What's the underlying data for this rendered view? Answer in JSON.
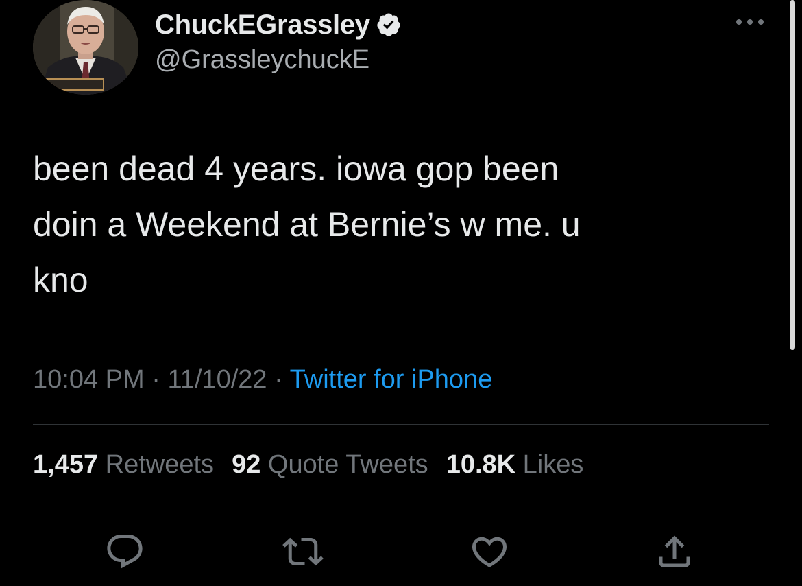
{
  "profile": {
    "display_name": "ChuckEGrassley",
    "handle": "@GrassleychuckE",
    "verified": true,
    "avatar_nameplate": "GRASSLEY"
  },
  "tweet": {
    "text": "been dead 4 years. iowa gop been\ndoin a Weekend at Bernie’s w me. u\nkno"
  },
  "meta": {
    "time": "10:04 PM",
    "separator1": " · ",
    "date": "11/10/22",
    "separator2": " · ",
    "source": "Twitter for iPhone"
  },
  "stats": {
    "retweets_count": "1,457",
    "retweets_label": "Retweets",
    "quote_count": "92",
    "quote_label": "Quote Tweets",
    "likes_count": "10.8K",
    "likes_label": "Likes"
  },
  "colors": {
    "background": "#000000",
    "text_primary": "#e7e9ea",
    "text_secondary": "#71767b",
    "link": "#1d9bf0",
    "divider": "#2f3336"
  },
  "icons": {
    "more": "more-horizontal-icon",
    "verified": "verified-badge-icon",
    "reply": "reply-icon",
    "retweet": "retweet-icon",
    "like": "heart-icon",
    "share": "share-icon"
  }
}
